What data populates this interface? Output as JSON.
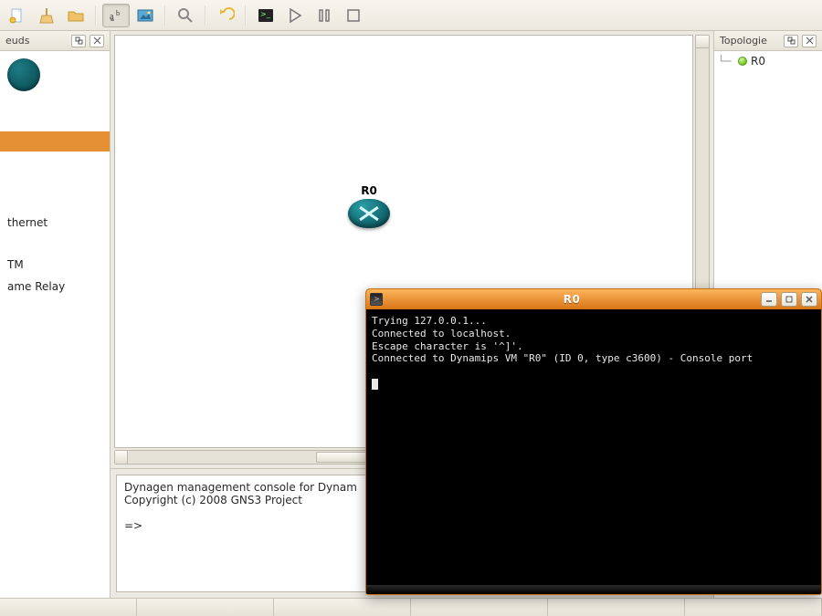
{
  "left_panel": {
    "title": "euds",
    "items": [
      {
        "label": "",
        "selected": true
      },
      {
        "label": "thernet"
      },
      {
        "label": "TM"
      },
      {
        "label": "ame Relay"
      }
    ]
  },
  "topology_panel": {
    "title": "Topologie",
    "nodes": [
      {
        "label": "R0",
        "status": "running"
      }
    ]
  },
  "canvas": {
    "node_label": "R0"
  },
  "bottom_console": {
    "line1": "Dynagen management console for Dynam",
    "line2": "Copyright (c) 2008 GNS3 Project",
    "blank": "",
    "prompt": "=>"
  },
  "terminal": {
    "title": "R0",
    "lines": [
      "Trying 127.0.0.1...",
      "Connected to localhost.",
      "Escape character is '^]'.",
      "Connected to Dynamips VM \"R0\" (ID 0, type c3600) - Console port",
      ""
    ]
  }
}
